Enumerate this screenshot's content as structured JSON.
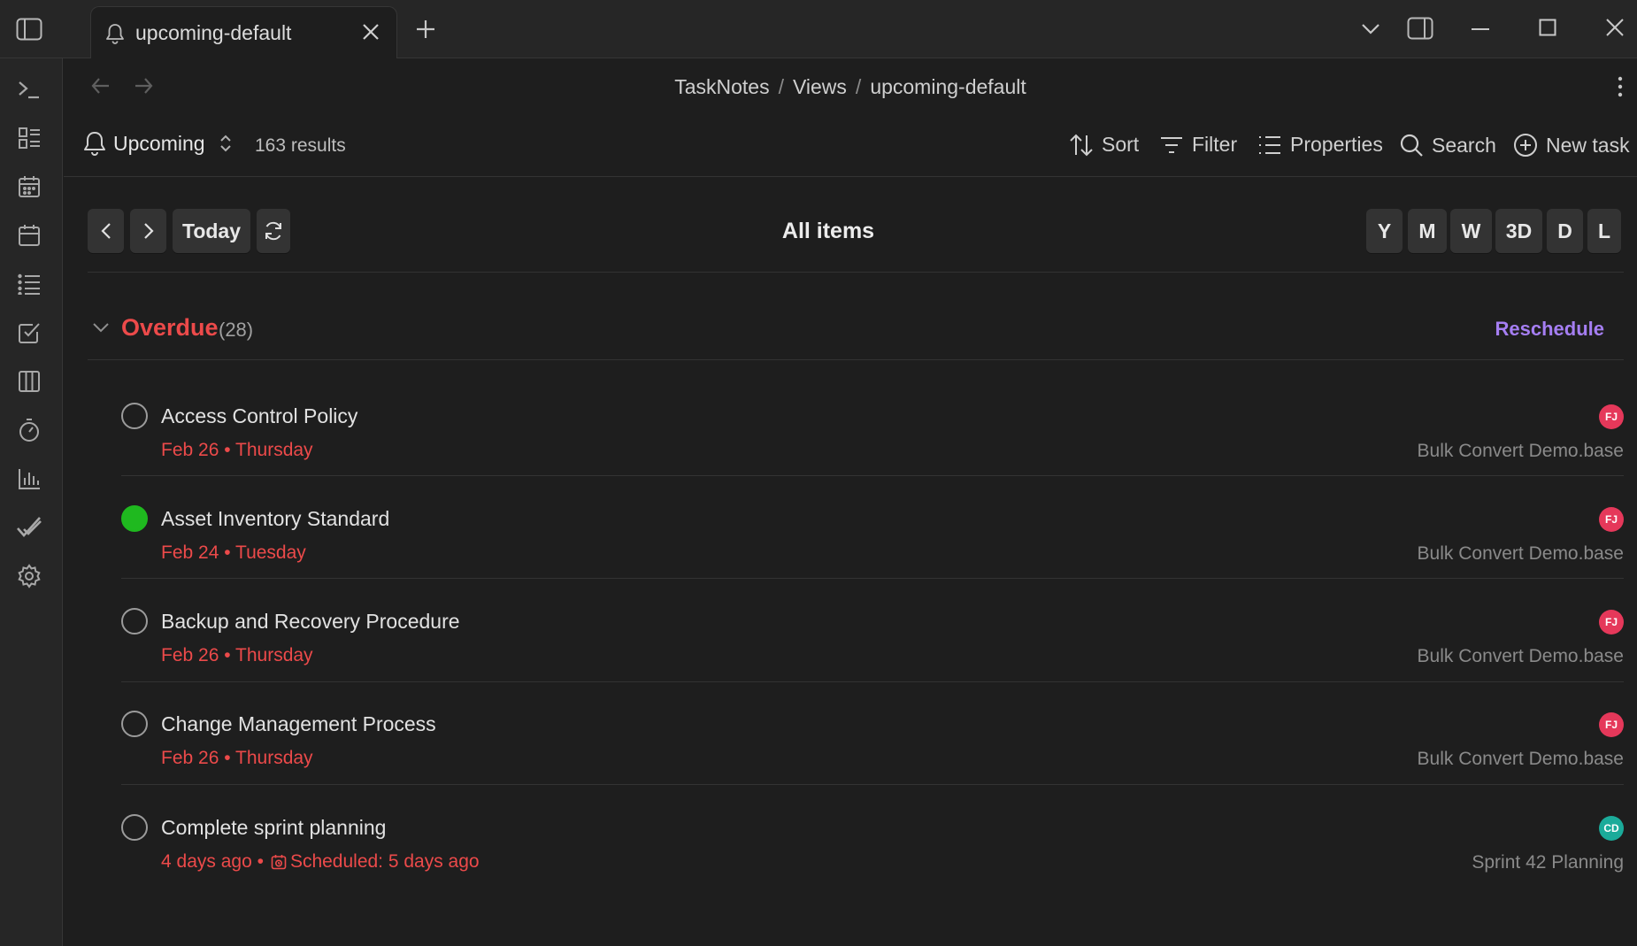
{
  "tab": {
    "title": "upcoming-default"
  },
  "breadcrumb": [
    "TaskNotes",
    "Views",
    "upcoming-default"
  ],
  "view": {
    "name": "Upcoming",
    "results": "163 results"
  },
  "toolbar": {
    "sort": "Sort",
    "filter": "Filter",
    "properties": "Properties",
    "search": "Search",
    "new_task": "New task"
  },
  "calendar": {
    "today": "Today",
    "title": "All items",
    "modes": [
      "Y",
      "M",
      "W",
      "3D",
      "D",
      "L"
    ]
  },
  "group": {
    "title": "Overdue",
    "count": "(28)",
    "action": "Reschedule"
  },
  "tasks": [
    {
      "title": "Access Control Policy",
      "date": "Feb 26 • Thursday",
      "avatar": "FJ",
      "source": "Bulk Convert Demo.base",
      "done": false
    },
    {
      "title": "Asset Inventory Standard",
      "date": "Feb 24 • Tuesday",
      "avatar": "FJ",
      "source": "Bulk Convert Demo.base",
      "done": true
    },
    {
      "title": "Backup and Recovery Procedure",
      "date": "Feb 26 • Thursday",
      "avatar": "FJ",
      "source": "Bulk Convert Demo.base",
      "done": false
    },
    {
      "title": "Change Management Process",
      "date": "Feb 26 • Thursday",
      "avatar": "FJ",
      "source": "Bulk Convert Demo.base",
      "done": false
    },
    {
      "title": "Complete sprint planning",
      "date": "4 days ago •",
      "scheduled": "Scheduled: 5 days ago",
      "avatar": "CD",
      "source": "Sprint 42 Planning",
      "done": false
    }
  ],
  "colors": {
    "overdue": "#ec4a4a",
    "accent": "#a57ef2",
    "done": "#1fb91f",
    "avatar_fj": "#e5385a",
    "avatar_cd": "#1bab9a"
  },
  "icons": [
    "sidebar-toggle-icon",
    "bell-icon",
    "close-icon",
    "plus-icon",
    "chevron-down-icon",
    "right-panel-icon",
    "minimize-icon",
    "maximize-icon",
    "terminal-icon",
    "dashboard-icon",
    "calendar-icon",
    "list-icon",
    "checkbox-icon",
    "kanban-icon",
    "timer-icon",
    "chart-icon",
    "checkmark-icon",
    "gear-icon",
    "sort-icon",
    "filter-icon",
    "properties-icon",
    "search-icon",
    "plus-circle-icon",
    "refresh-icon"
  ]
}
